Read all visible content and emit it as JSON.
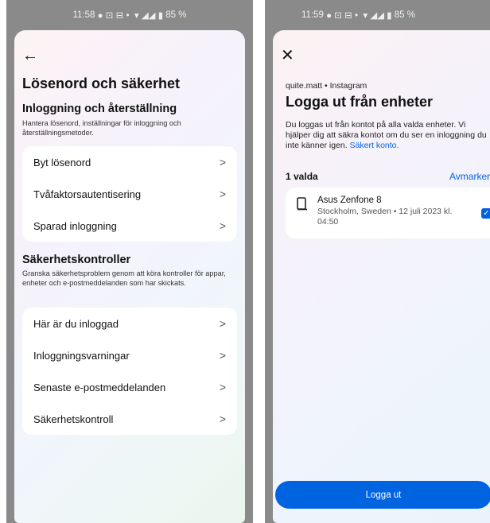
{
  "left": {
    "status": {
      "time": "11:58",
      "indicators": "● ⊡ ⊟  •",
      "icons": "▾ ◢◢ ▮",
      "battery": "85 %"
    },
    "title": "Lösenord och säkerhet",
    "login_section": {
      "heading": "Inloggning och återställning",
      "description": "Hantera lösenord, inställningar för inloggning och återställningsmetoder.",
      "items": [
        {
          "label": "Byt lösenord"
        },
        {
          "label": "Tvåfaktorsautentisering"
        },
        {
          "label": "Sparad inloggning"
        }
      ]
    },
    "checks_section": {
      "heading": "Säkerhetskontroller",
      "description": "Granska säkerhetsproblem genom att köra kontroller för appar, enheter och e-postmeddelanden som har skickats.",
      "items": [
        {
          "label": "Här är du inloggad"
        },
        {
          "label": "Inloggningsvarningar"
        },
        {
          "label": "Senaste e-postmeddelanden"
        },
        {
          "label": "Säkerhetskontroll"
        }
      ]
    },
    "chevron": ">"
  },
  "right": {
    "status": {
      "time": "11:59",
      "indicators": "● ⊡ ⊟  •",
      "icons": "▾ ◢◢ ▮",
      "battery": "85 %"
    },
    "account_line": "quite.matt • Instagram",
    "title": "Logga ut från enheter",
    "description": "Du loggas ut från kontot på alla valda enheter. Vi hjälper dig att säkra kontot om du ser en inloggning du inte känner igen.",
    "secure_link": "Säkert konto.",
    "selected_count": "1 valda",
    "deselect_label": "Avmarkera",
    "device": {
      "name": "Asus Zenfone 8",
      "meta": "Stockholm, Sweden • 12 juli 2023 kl. 04:50",
      "checked": true
    },
    "logout_label": "Logga ut"
  },
  "colors": {
    "accent": "#0064e0",
    "frame": "#8a8a8a"
  }
}
